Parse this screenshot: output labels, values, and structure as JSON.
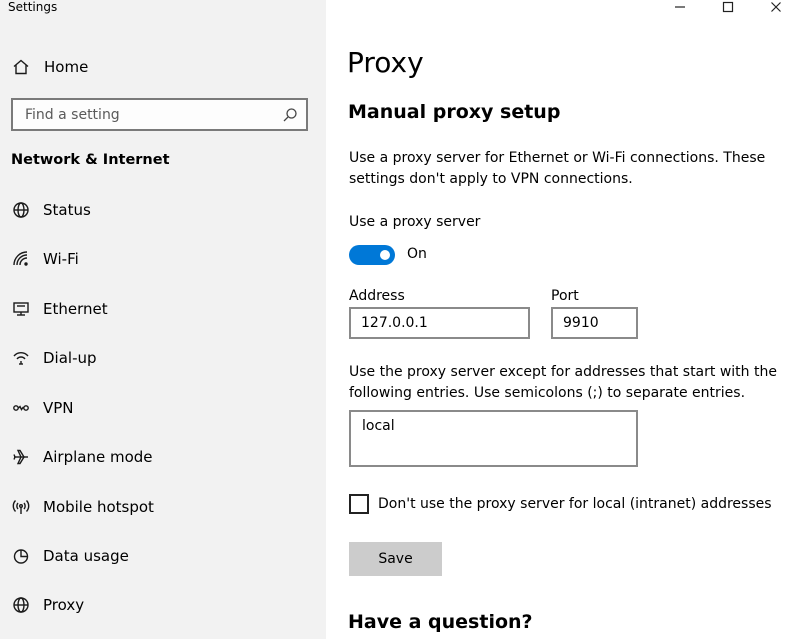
{
  "window": {
    "title": "Settings",
    "controls": [
      "minimize",
      "maximize",
      "close"
    ]
  },
  "sidebar": {
    "home_label": "Home",
    "search_placeholder": "Find a setting",
    "section": "Network & Internet",
    "items": [
      {
        "label": "Status",
        "icon": "globe-status-icon"
      },
      {
        "label": "Wi-Fi",
        "icon": "wifi-icon"
      },
      {
        "label": "Ethernet",
        "icon": "ethernet-icon"
      },
      {
        "label": "Dial-up",
        "icon": "dialup-icon"
      },
      {
        "label": "VPN",
        "icon": "vpn-icon"
      },
      {
        "label": "Airplane mode",
        "icon": "airplane-icon"
      },
      {
        "label": "Mobile hotspot",
        "icon": "hotspot-icon"
      },
      {
        "label": "Data usage",
        "icon": "data-usage-icon"
      },
      {
        "label": "Proxy",
        "icon": "globe-icon"
      }
    ]
  },
  "main": {
    "title": "Proxy",
    "section_title": "Manual proxy setup",
    "description": "Use a proxy server for Ethernet or Wi-Fi connections. These settings don't apply to VPN connections.",
    "use_proxy_label": "Use a proxy server",
    "toggle_state": "On",
    "toggle_on": true,
    "address_label": "Address",
    "address_value": "127.0.0.1",
    "port_label": "Port",
    "port_value": "9910",
    "exceptions_text": "Use the proxy server except for addresses that start with the following entries. Use semicolons (;) to separate entries.",
    "exceptions_value": "local",
    "local_checkbox_label": "Don't use the proxy server for local (intranet) addresses",
    "local_checked": false,
    "save_label": "Save",
    "question_heading": "Have a question?"
  },
  "colors": {
    "accent": "#0078d7",
    "sidebar_bg": "#f2f2f2",
    "button_bg": "#cccccc"
  }
}
